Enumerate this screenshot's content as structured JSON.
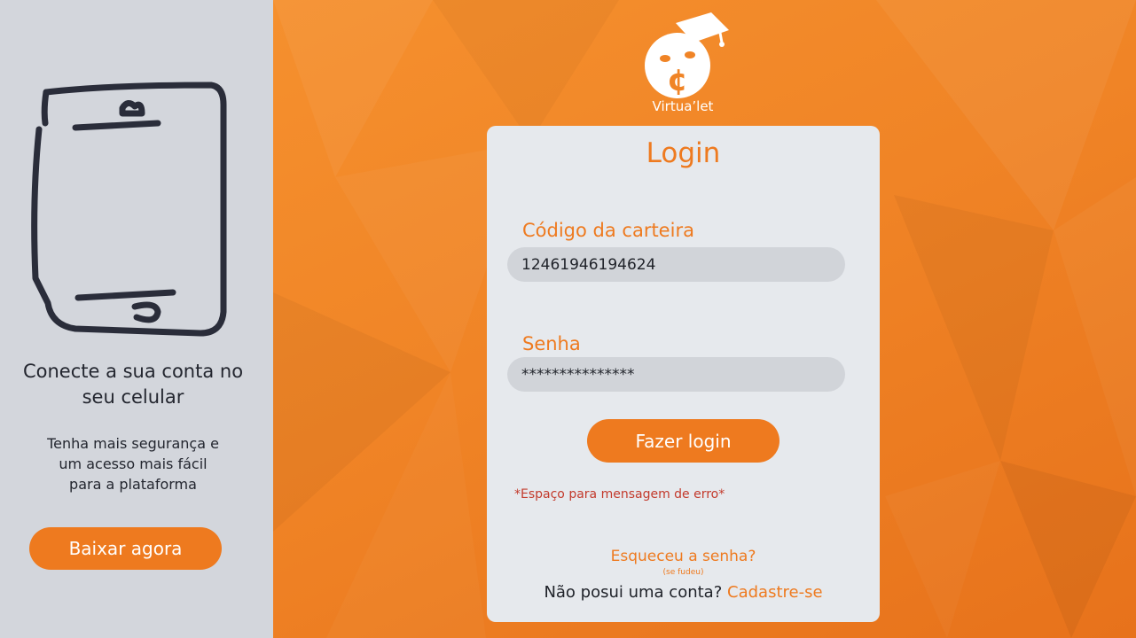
{
  "sidebar": {
    "illustration_icon": "phone-sketch-icon",
    "promo_title_line1": "Conecte a sua conta no",
    "promo_title_line2": "seu celular",
    "promo_body_line1": "Tenha mais segurança e",
    "promo_body_line2": "um acesso mais fácil",
    "promo_body_line3": "para a plataforma",
    "download_label": "Baixar agora"
  },
  "brand": {
    "logo_icon": "graduation-cap-coin-icon",
    "name": "Virtua’let"
  },
  "login": {
    "title": "Login",
    "wallet_label": "Código da carteira",
    "wallet_value": "12461946194624",
    "password_label": "Senha",
    "password_value": "***************",
    "submit_label": "Fazer login",
    "error_message": "*Espaço para mensagem de erro*",
    "forgot_label": "Esqueceu a senha?",
    "forgot_note": "(se fudeu)",
    "no_account_text": "Não posui uma conta?",
    "signup_label": "Cadastre-se"
  },
  "colors": {
    "accent": "#ee7a1f",
    "sidebar_bg": "#d3d6dc",
    "card_bg": "#e6e9ed",
    "input_bg": "#d1d4d9",
    "error": "#c33a2c"
  }
}
